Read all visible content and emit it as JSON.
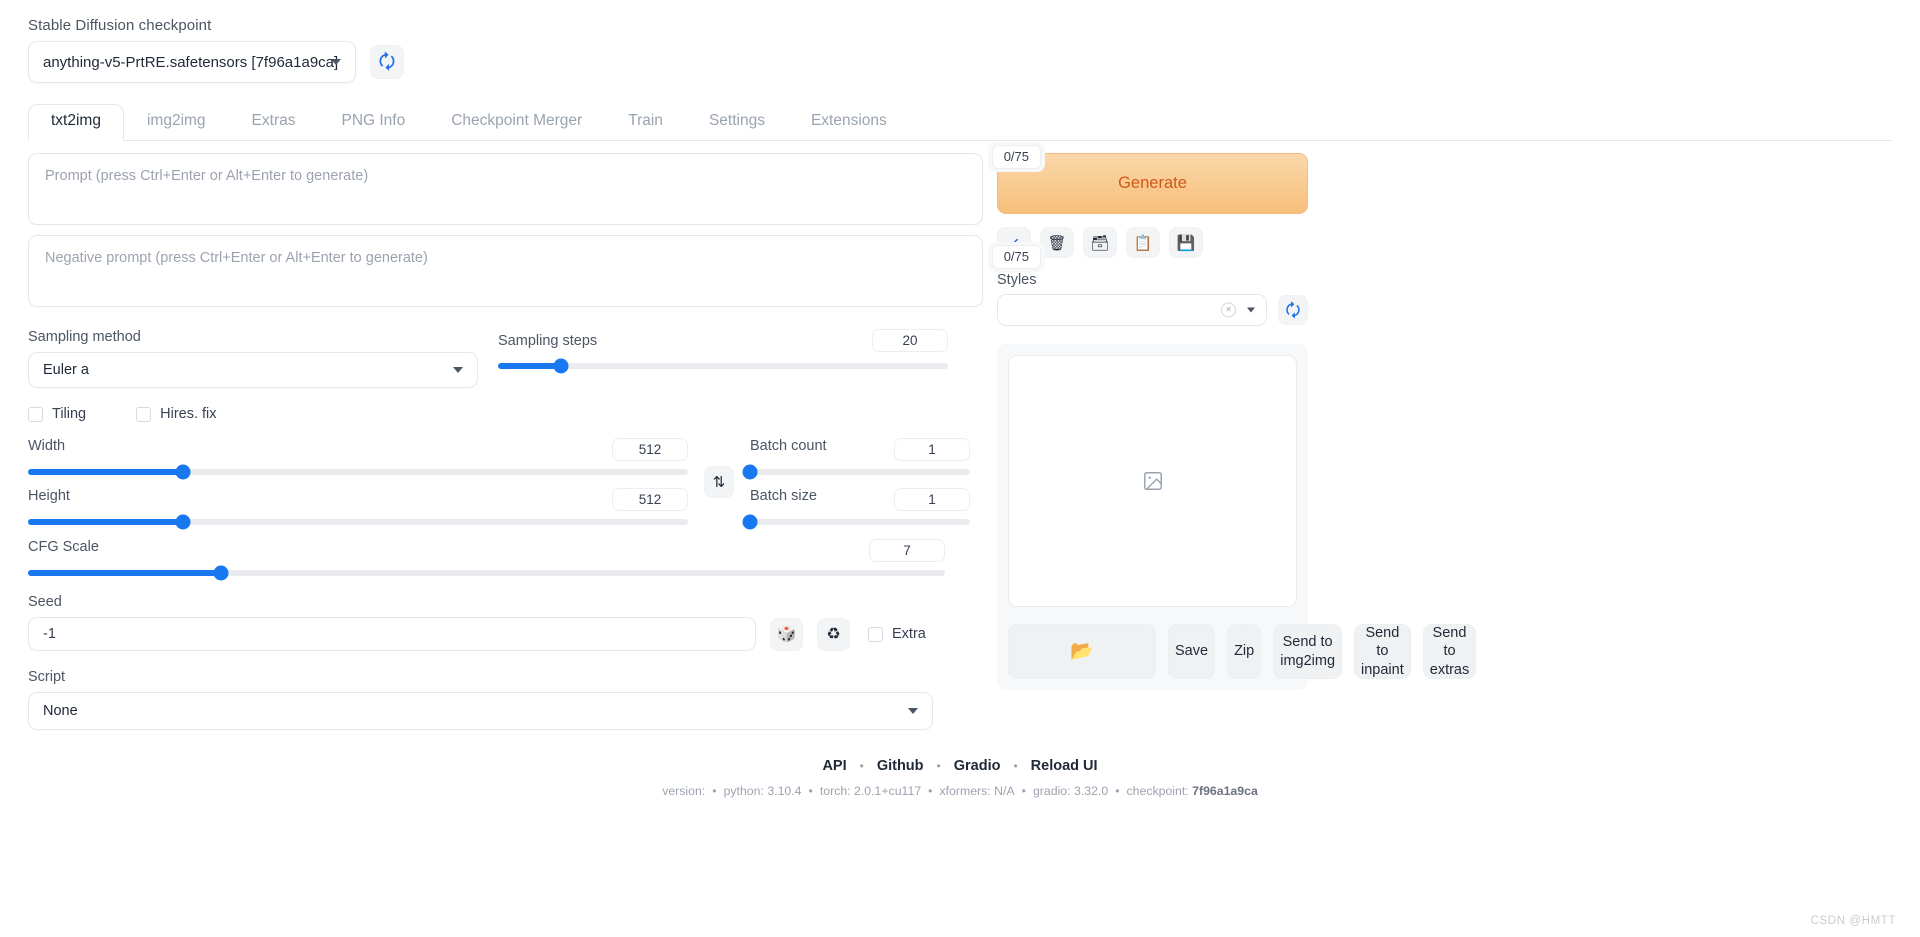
{
  "checkpoint": {
    "label": "Stable Diffusion checkpoint",
    "value": "anything-v5-PrtRE.safetensors [7f96a1a9ca]",
    "refresh_icon": "refresh-icon"
  },
  "tabs": [
    {
      "label": "txt2img",
      "active": true
    },
    {
      "label": "img2img",
      "active": false
    },
    {
      "label": "Extras",
      "active": false
    },
    {
      "label": "PNG Info",
      "active": false
    },
    {
      "label": "Checkpoint Merger",
      "active": false
    },
    {
      "label": "Train",
      "active": false
    },
    {
      "label": "Settings",
      "active": false
    },
    {
      "label": "Extensions",
      "active": false
    }
  ],
  "prompts": {
    "positive_placeholder": "Prompt (press Ctrl+Enter or Alt+Enter to generate)",
    "positive_value": "",
    "positive_tokens": "0/75",
    "negative_placeholder": "Negative prompt (press Ctrl+Enter or Alt+Enter to generate)",
    "negative_value": "",
    "negative_tokens": "0/75"
  },
  "generate": {
    "label": "Generate",
    "accent_color": "#f6bf7c",
    "text_color": "#d2571b"
  },
  "toolbar_icons": [
    {
      "name": "restore-progress-icon",
      "glyph": "↙"
    },
    {
      "name": "trash-icon",
      "glyph": "🗑"
    },
    {
      "name": "card-file-box-icon",
      "glyph": "🗃"
    },
    {
      "name": "clipboard-icon",
      "glyph": "📋"
    },
    {
      "name": "floppy-disk-icon",
      "glyph": "💾"
    }
  ],
  "styles": {
    "label": "Styles",
    "value": "",
    "clear_glyph": "×",
    "refresh_icon": "refresh-icon"
  },
  "sampling": {
    "method_label": "Sampling method",
    "method_value": "Euler a",
    "steps_label": "Sampling steps",
    "steps_value": "20",
    "steps_percent": 14
  },
  "checkboxes": [
    {
      "label": "Tiling",
      "checked": false
    },
    {
      "label": "Hires. fix",
      "checked": false
    }
  ],
  "dimensions": {
    "width_label": "Width",
    "width_value": "512",
    "width_percent": 23.5,
    "height_label": "Height",
    "height_value": "512",
    "height_percent": 23.5,
    "swap_glyph": "⇅"
  },
  "batch": {
    "count_label": "Batch count",
    "count_value": "1",
    "count_percent": 0,
    "size_label": "Batch size",
    "size_value": "1",
    "size_percent": 0
  },
  "cfg": {
    "label": "CFG Scale",
    "value": "7",
    "percent": 21
  },
  "seed": {
    "label": "Seed",
    "value": "-1",
    "dice_icon": "🎲",
    "recycle_icon": "♻",
    "extra_label": "Extra",
    "extra_checked": false
  },
  "script": {
    "label": "Script",
    "value": "None"
  },
  "output": {
    "placeholder_icon": "image-placeholder-icon",
    "buttons": [
      {
        "name": "open-folder-button",
        "label": "📂",
        "is_icon": true
      },
      {
        "name": "save-button",
        "label": "Save",
        "is_icon": false
      },
      {
        "name": "zip-button",
        "label": "Zip",
        "is_icon": false
      },
      {
        "name": "send-to-img2img-button",
        "label": "Send to img2img",
        "is_icon": false
      },
      {
        "name": "send-to-inpaint-button",
        "label": "Send to inpaint",
        "is_icon": false
      },
      {
        "name": "send-to-extras-button",
        "label": "Send to extras",
        "is_icon": false
      }
    ]
  },
  "footer": {
    "links": [
      "API",
      "Github",
      "Gradio",
      "Reload UI"
    ],
    "separator": "•",
    "meta": [
      {
        "key": "version:",
        "val": ""
      },
      {
        "key": "python:",
        "val": "3.10.4"
      },
      {
        "key": "torch:",
        "val": "2.0.1+cu117"
      },
      {
        "key": "xformers:",
        "val": "N/A"
      },
      {
        "key": "gradio:",
        "val": "3.32.0"
      },
      {
        "key": "checkpoint:",
        "val": "7f96a1a9ca"
      }
    ]
  },
  "watermark": "CSDN @HMTT"
}
